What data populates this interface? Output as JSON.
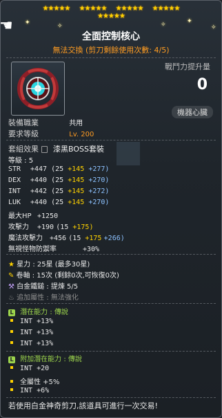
{
  "header": {
    "title": "全面控制核心",
    "trade_status": "無法交換 (剪刀剩餘使用次數: 4/5)"
  },
  "power": {
    "label": "戰鬥力提升量",
    "value": "0",
    "badge": "機器心臟"
  },
  "requirements": {
    "job_label": "裝備職業",
    "job_value": "共用",
    "level_label": "要求等級",
    "level_value": "Lv. 200"
  },
  "set": {
    "label": "套組效果",
    "value": "漆黑BOSS套裝"
  },
  "stats": {
    "level": "等級 : 5",
    "str": {
      "name": "STR",
      "total": "+447",
      "base": "(25 ",
      "bonus": "+145",
      "upgrade": "+277)"
    },
    "dex": {
      "name": "DEX",
      "total": "+440",
      "base": "(25 ",
      "bonus": "+145",
      "upgrade": "+270)"
    },
    "int": {
      "name": "INT",
      "total": "+442",
      "base": "(25 ",
      "bonus": "+145",
      "upgrade": "+272)"
    },
    "luk": {
      "name": "LUK",
      "total": "+440",
      "base": "(25 ",
      "bonus": "+145",
      "upgrade": "+270)"
    },
    "hp": {
      "name": "最大HP",
      "value": "+1250"
    },
    "att": {
      "name": "攻擊力",
      "total": "+190",
      "base": "(15 ",
      "bonus": "+175)"
    },
    "matt": {
      "name": "魔法攻擊力",
      "total": "+456",
      "base": "(15 ",
      "bonus": "+175",
      "upgrade": "+266)"
    },
    "ied": {
      "name": "無視怪物防禦率",
      "value": "+30%"
    }
  },
  "upgrades": {
    "star_force": "星力 : 25星 (最多30星)",
    "scrolls": "卷軸 : 15次 (剩餘0次,可恢復0次)",
    "hammer": "白金鐵鎚 : 提煉 5/5",
    "flame": "追加屬性 : 無法強化"
  },
  "potential": {
    "title": "潛在能力 : 傳說",
    "lines": [
      "INT +13%",
      "INT +13%",
      "INT +13%"
    ]
  },
  "bonus_potential": {
    "title": "附加潛在能力 : 傳說",
    "lines": [
      "INT +20",
      "全屬性 +5%",
      "INT +6%"
    ]
  },
  "footer": "若使用白金神奇剪刀,該道具可進行一次交易!"
}
